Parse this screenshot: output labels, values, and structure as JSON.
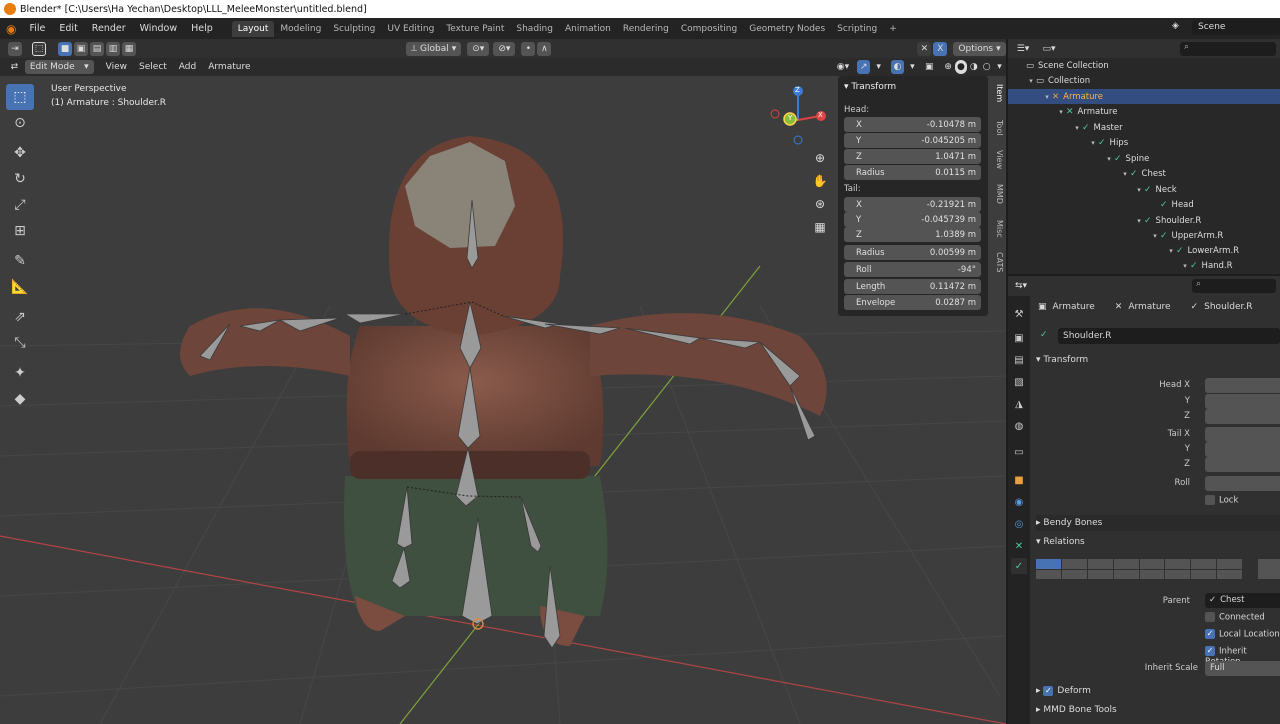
{
  "window": {
    "title": "Blender* [C:\\Users\\Ha Yechan\\Desktop\\LLL_MeleeMonster\\untitled.blend]"
  },
  "menu": [
    "File",
    "Edit",
    "Render",
    "Window",
    "Help"
  ],
  "workspaces": [
    "Layout",
    "Modeling",
    "Sculpting",
    "UV Editing",
    "Texture Paint",
    "Shading",
    "Animation",
    "Rendering",
    "Compositing",
    "Geometry Nodes",
    "Scripting"
  ],
  "scene": "Scene",
  "header": {
    "orientation": "Global",
    "options": "Options",
    "mode": "Edit Mode",
    "menus": [
      "View",
      "Select",
      "Add",
      "Armature"
    ]
  },
  "viewport": {
    "perspective": "User Perspective",
    "object_info": "(1) Armature : Shoulder.R",
    "gizmo": {
      "x": "X",
      "y": "Y",
      "z": "Z"
    }
  },
  "npanel": {
    "title": "Transform",
    "head_label": "Head:",
    "head": [
      {
        "k": "X",
        "v": "-0.10478 m"
      },
      {
        "k": "Y",
        "v": "-0.045205 m"
      },
      {
        "k": "Z",
        "v": "1.0471 m"
      },
      {
        "k": "Radius",
        "v": "0.0115 m"
      }
    ],
    "tail_label": "Tail:",
    "tail": [
      {
        "k": "X",
        "v": "-0.21921 m"
      },
      {
        "k": "Y",
        "v": "-0.045739 m"
      },
      {
        "k": "Z",
        "v": "1.0389 m"
      },
      {
        "k": "Radius",
        "v": "0.00599 m"
      },
      {
        "k": "Roll",
        "v": "-94°"
      },
      {
        "k": "Length",
        "v": "0.11472 m"
      },
      {
        "k": "Envelope",
        "v": "0.0287 m"
      }
    ],
    "tabs": [
      "Item",
      "Tool",
      "View",
      "MMD",
      "Misc",
      "CATS"
    ]
  },
  "outliner": {
    "rows": [
      {
        "label": "Scene Collection",
        "indent": 0
      },
      {
        "label": "Collection",
        "indent": 1
      },
      {
        "label": "Armature",
        "indent": 2,
        "selected": true
      },
      {
        "label": "Armature",
        "indent": 3
      },
      {
        "label": "Master",
        "indent": 4
      },
      {
        "label": "Hips",
        "indent": 5
      },
      {
        "label": "Spine",
        "indent": 6
      },
      {
        "label": "Chest",
        "indent": 7
      },
      {
        "label": "Neck",
        "indent": 8
      },
      {
        "label": "Head",
        "indent": 9
      },
      {
        "label": "Shoulder.R",
        "indent": 8
      },
      {
        "label": "UpperArm.R",
        "indent": 9
      },
      {
        "label": "LowerArm.R",
        "indent": 10
      },
      {
        "label": "Hand.R",
        "indent": 11
      }
    ]
  },
  "properties": {
    "breadcrumb": [
      "Armature",
      "Armature",
      "Shoulder.R"
    ],
    "bone_name": "Shoulder.R",
    "transform": "Transform",
    "labels": {
      "headx": "Head X",
      "y": "Y",
      "z": "Z",
      "tailx": "Tail X",
      "roll": "Roll",
      "lock": "Lock"
    },
    "bendy": "Bendy Bones",
    "relations": "Relations",
    "parent_label": "Parent",
    "parent": "Chest",
    "connected": "Connected",
    "local_location": "Local Location",
    "inherit_rotation": "Inherit Rotation",
    "inherit_scale_label": "Inherit Scale",
    "inherit_scale": "Full",
    "deform": "Deform",
    "mmd": "MMD Bone Tools"
  }
}
